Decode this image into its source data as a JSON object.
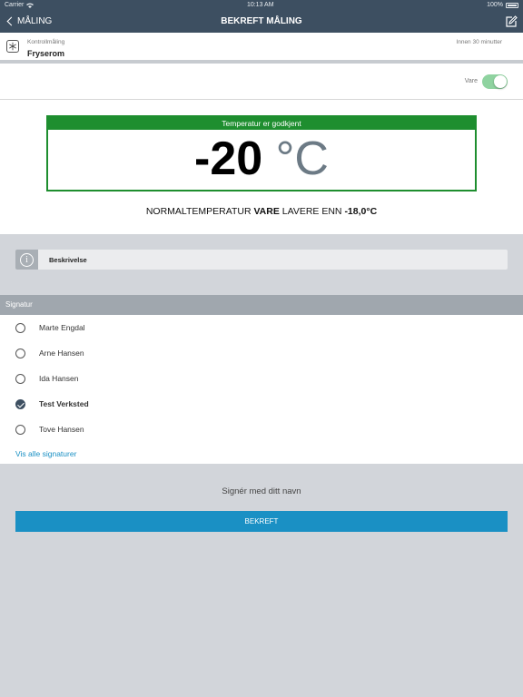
{
  "status_bar": {
    "carrier": "Carrier",
    "time": "10:13 AM",
    "battery": "100%"
  },
  "nav": {
    "back_label": "MÅLING",
    "title": "BEKREFT MÅLING",
    "edit_icon": "edit-icon"
  },
  "header": {
    "subtitle": "Kontrollmåling",
    "title": "Fryserom",
    "due": "Innen 30 minutter",
    "icon": "snowflake-icon"
  },
  "toggle": {
    "label": "Vare",
    "on": true,
    "color": "#8fd3a0"
  },
  "temperature": {
    "status": "Temperatur er godkjent",
    "value": "-20",
    "unit": "°C",
    "status_color": "#1e8e2f",
    "norm_prefix": "NORMALTEMPERATUR ",
    "norm_item": "VARE",
    "norm_middle": " LAVERE ENN ",
    "norm_value": "-18,0°C"
  },
  "description": {
    "label": "Beskrivelse",
    "icon": "info-icon"
  },
  "signature": {
    "header": "Signatur",
    "options": [
      {
        "name": "Marte Engdal",
        "checked": false
      },
      {
        "name": "Arne Hansen",
        "checked": false
      },
      {
        "name": "Ida Hansen",
        "checked": false
      },
      {
        "name": "Test Verksted",
        "checked": true
      },
      {
        "name": "Tove Hansen",
        "checked": false
      }
    ],
    "show_all": "Vis alle signaturer"
  },
  "footer": {
    "sign_label": "Signér med ditt navn",
    "confirm_label": "BEKREFT",
    "accent": "#1a90c4"
  }
}
